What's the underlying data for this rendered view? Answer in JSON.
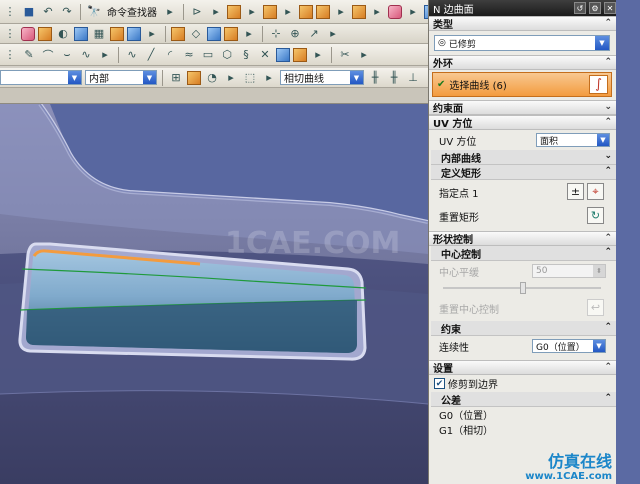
{
  "toolbar": {
    "command_finder": "命令查找器",
    "selection_filter": "内部",
    "curve_rule": "相切曲线"
  },
  "panel": {
    "title": "N 边曲面",
    "type_section": "类型",
    "type_value": "已修剪",
    "outer_loop_section": "外环",
    "select_curve_label": "选择曲线 (6)",
    "constraint_face_section": "约束面",
    "uv_section": "UV 方位",
    "uv_label": "UV 方位",
    "uv_value": "面积",
    "inner_curves": "内部曲线",
    "define_rect": "定义矩形",
    "specify_point": "指定点 1",
    "reset_rect": "重置矩形",
    "shape_control_section": "形状控制",
    "center_control": "中心控制",
    "center_flat_label": "中心平缓",
    "center_flat_value": "50",
    "reset_center": "重置中心控制",
    "constraint_sub": "约束",
    "continuity_label": "连续性",
    "continuity_value": "G0（位置）",
    "settings_section": "设置",
    "trim_to_boundary": "修剪到边界",
    "tolerance": "公差",
    "g0_label": "G0（位置）",
    "g1_label": "G1（相切）"
  },
  "watermark": {
    "text": "1CAE.COM",
    "brand": "仿真在线",
    "site": "www.1CAE.com"
  },
  "colors": {
    "accent": "#f39b3e",
    "viewport_bg": "#6b6f96",
    "panel_bg": "#ecebe6"
  }
}
